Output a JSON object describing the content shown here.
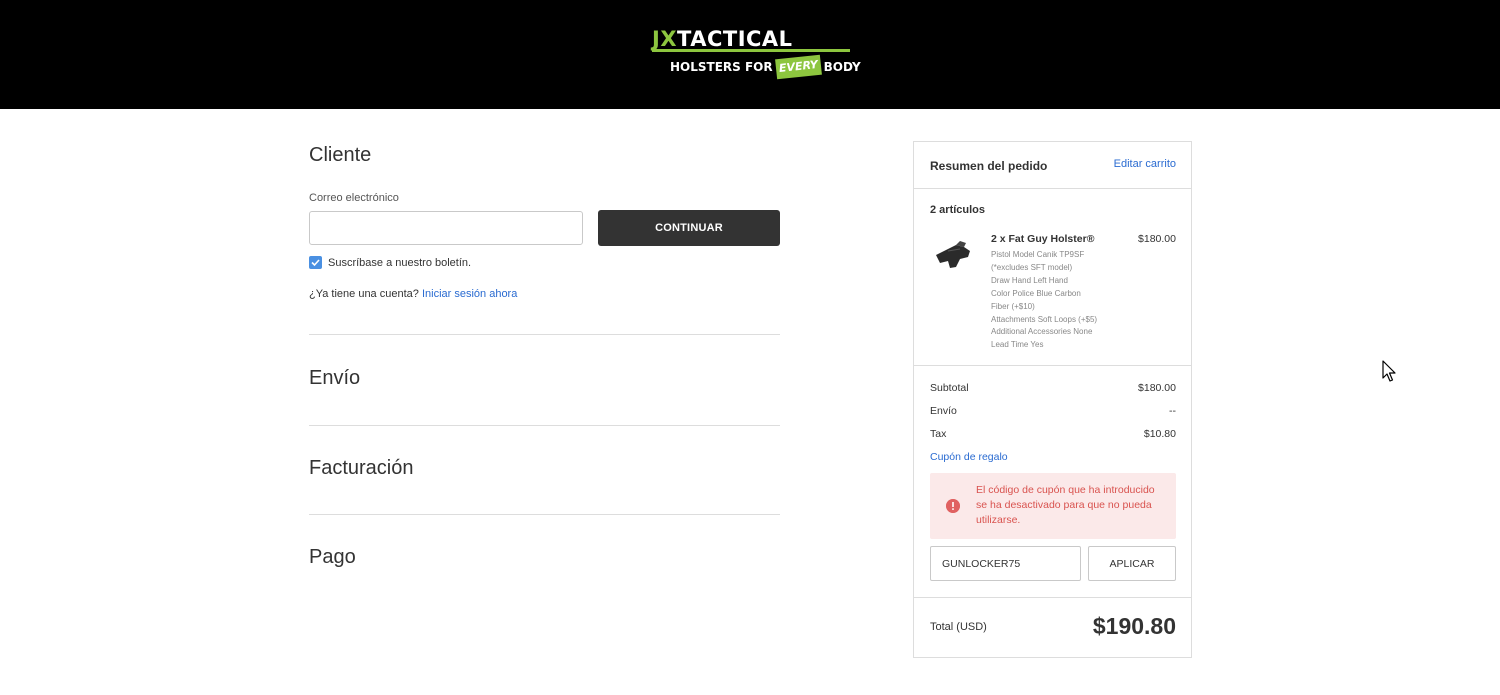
{
  "header": {
    "logo_top_jx": "JX",
    "logo_top_rest": "TACTICAL",
    "logo_bottom_left": "HOLSTERS FOR",
    "logo_bottom_every": "EVERY",
    "logo_bottom_right": "BODY"
  },
  "customer": {
    "title": "Cliente",
    "email_label": "Correo electrónico",
    "email_value": "",
    "continue_label": "CONTINUAR",
    "newsletter_label": "Suscríbase a nuestro boletín.",
    "newsletter_checked": true,
    "account_prompt": "¿Ya tiene una cuenta?",
    "login_link": "Iniciar sesión ahora"
  },
  "sections": {
    "shipping": "Envío",
    "billing": "Facturación",
    "payment": "Pago"
  },
  "summary": {
    "title": "Resumen del pedido",
    "edit_cart": "Editar carrito",
    "item_count": "2 artículos",
    "item": {
      "name": "2 x Fat Guy Holster®",
      "price": "$180.00",
      "options": [
        "Pistol Model Canik TP9SF",
        "(*excludes SFT model)",
        "Draw Hand Left Hand",
        "Color Police Blue Carbon",
        "Fiber (+$10)",
        "Attachments Soft Loops (+$5)",
        "Additional Accessories None",
        "Lead Time Yes"
      ]
    },
    "subtotal_label": "Subtotal",
    "subtotal_value": "$180.00",
    "shipping_label": "Envío",
    "shipping_value": "--",
    "tax_label": "Tax",
    "tax_value": "$10.80",
    "coupon_link": "Cupón de regalo",
    "error_message": "El código de cupón que ha introducido se ha desactivado para que no pueda utilizarse.",
    "coupon_value": "GUNLOCKER75",
    "apply_label": "APLICAR",
    "total_label": "Total (USD)",
    "total_value": "$190.80"
  },
  "colors": {
    "brand_green": "#8dc63f",
    "link_blue": "#2a6bd1",
    "error_red": "#d9534f",
    "error_bg": "#fbe9e9",
    "button_dark": "#333333"
  }
}
